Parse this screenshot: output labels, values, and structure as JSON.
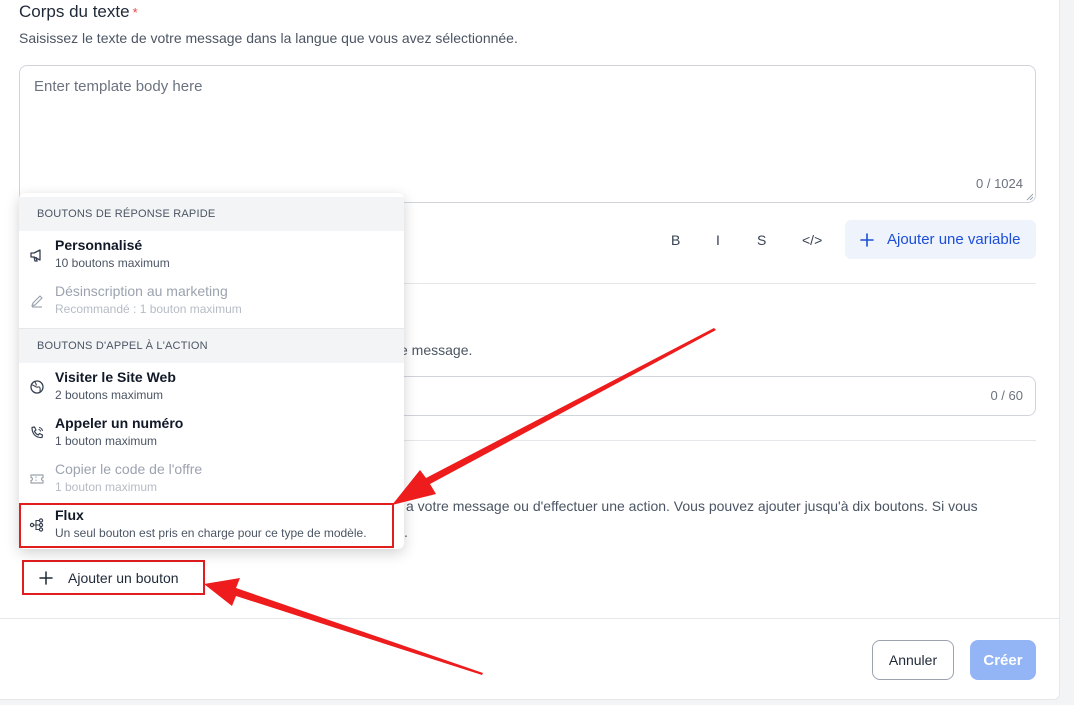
{
  "body_section": {
    "title": "Corps du texte",
    "required_mark": "*",
    "hint": "Saisissez le texte de votre message dans la langue que vous avez sélectionnée.",
    "placeholder": "Enter template body here",
    "counter": "0 / 1024"
  },
  "toolbar": {
    "bold": "B",
    "italic": "I",
    "strike": "S",
    "code": "</>",
    "add_variable": "Ajouter une variable"
  },
  "footer_section": {
    "hint_tail": "e message.",
    "counter": "0 / 60"
  },
  "buttons_section": {
    "hint_tail": "a votre message ou d'effectuer une action. Vous pouvez ajouter jusqu'à dix boutons. Si vous",
    "hint_tail2": ".",
    "add_button": "Ajouter un bouton"
  },
  "menu": {
    "quick_reply_header": "BOUTONS DE RÉPONSE RAPIDE",
    "cta_header": "BOUTONS D'APPEL À L'ACTION",
    "items": [
      {
        "label": "Personnalisé",
        "sub": "10 boutons maximum",
        "icon": "megaphone-icon",
        "disabled": false
      },
      {
        "label": "Désinscription au marketing",
        "sub": "Recommandé : 1 bouton maximum",
        "icon": "pencil-icon",
        "disabled": true
      },
      {
        "label": "Visiter le Site Web",
        "sub": "2 boutons maximum",
        "icon": "globe-icon",
        "disabled": false
      },
      {
        "label": "Appeler un numéro",
        "sub": "1 bouton maximum",
        "icon": "phone-icon",
        "disabled": false
      },
      {
        "label": "Copier le code de l'offre",
        "sub": "1 bouton maximum",
        "icon": "ticket-icon",
        "disabled": true
      },
      {
        "label": "Flux",
        "sub": "Un seul bouton est pris en charge pour ce type de modèle.",
        "icon": "flow-icon",
        "disabled": false
      }
    ]
  },
  "actions": {
    "cancel": "Annuler",
    "create": "Créer"
  },
  "colors": {
    "accent": "#1d4ed8",
    "highlight": "#e11d1d",
    "create_disabled": "#93b4f5"
  }
}
